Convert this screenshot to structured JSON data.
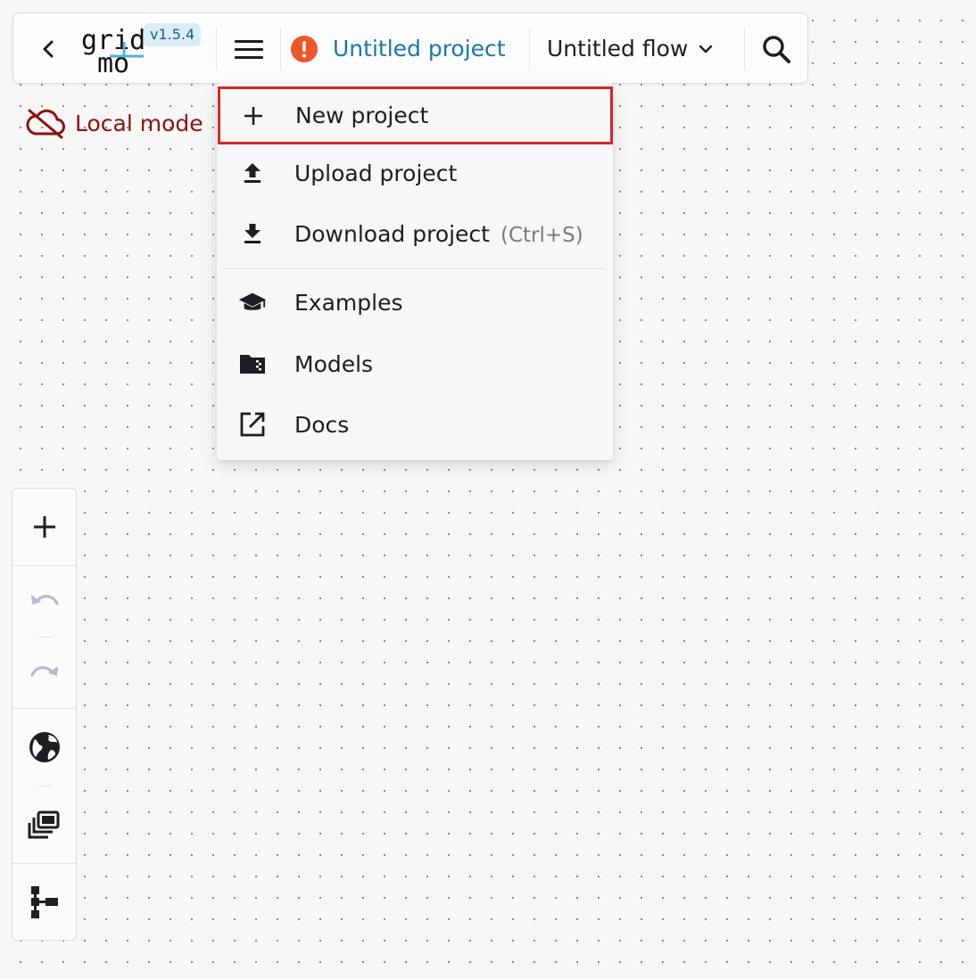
{
  "topbar": {
    "logo_line1": "grid",
    "logo_line2": "mo",
    "version": "v1.5.4",
    "project_name": "Untitled project",
    "flow_name": "Untitled flow",
    "icons": {
      "back": "chevron-left-icon",
      "menu": "hamburger-menu-icon",
      "warning": "alert-circle-icon",
      "flow_dropdown": "chevron-down-icon",
      "search": "search-icon"
    },
    "colors": {
      "project_link": "#1878a8",
      "warning": "#f0562b",
      "version_badge": "#daeef8"
    }
  },
  "status": {
    "local_mode_label": "Local mode",
    "icon": "cloud-off-icon",
    "color": "#8e1111"
  },
  "menu": {
    "items": [
      {
        "label": "New project",
        "icon": "plus-icon",
        "highlighted": true
      },
      {
        "label": "Upload project",
        "icon": "upload-icon"
      },
      {
        "label": "Download project",
        "shortcut": "(Ctrl+S)",
        "icon": "download-icon"
      },
      {
        "label": "Examples",
        "icon": "graduation-cap-icon"
      },
      {
        "label": "Models",
        "icon": "folder-icon"
      },
      {
        "label": "Docs",
        "icon": "external-link-icon"
      }
    ],
    "highlight_color": "#d7262a"
  },
  "toolbar": {
    "buttons": [
      {
        "name": "add",
        "icon": "plus-icon"
      },
      {
        "name": "undo",
        "icon": "undo-icon",
        "disabled": true
      },
      {
        "name": "redo",
        "icon": "redo-icon",
        "disabled": true
      },
      {
        "name": "globe",
        "icon": "globe-icon"
      },
      {
        "name": "copies",
        "icon": "library-icon"
      },
      {
        "name": "hierarchy",
        "icon": "hierarchy-icon"
      }
    ]
  }
}
